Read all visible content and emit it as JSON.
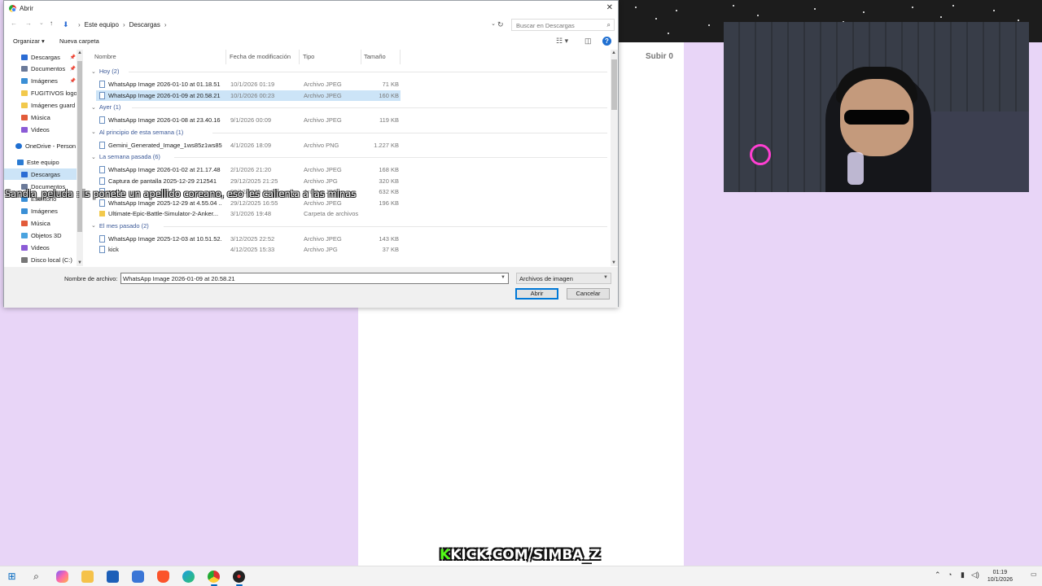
{
  "dialog": {
    "title": "Abrir",
    "close_glyph": "✕",
    "nav": {
      "back": "←",
      "forward": "→",
      "recent": "⌄",
      "up": "↑"
    },
    "breadcrumb": [
      "Este equipo",
      "Descargas"
    ],
    "breadcrumb_sep": "›",
    "search_placeholder": "Buscar en Descargas",
    "toolbar": {
      "organize": "Organizar ▾",
      "new_folder": "Nueva carpeta",
      "help": "?"
    },
    "sidebar": [
      {
        "label": "Descargas",
        "icon": "download-icon",
        "pinned": true
      },
      {
        "label": "Documentos",
        "icon": "document-icon",
        "pinned": true
      },
      {
        "label": "Imágenes",
        "icon": "image-icon",
        "pinned": true
      },
      {
        "label": "FUGITIVOS logo",
        "icon": "folder-icon"
      },
      {
        "label": "Imágenes guard",
        "icon": "folder-icon"
      },
      {
        "label": "Música",
        "icon": "music-icon"
      },
      {
        "label": "Videos",
        "icon": "video-icon"
      },
      {
        "label": "OneDrive - Person",
        "icon": "cloud-icon"
      },
      {
        "label": "Este equipo",
        "icon": "pc-icon"
      },
      {
        "label": "Descargas",
        "icon": "download-icon",
        "selected": true
      },
      {
        "label": "Documentos",
        "icon": "document-icon"
      },
      {
        "label": "Escritorio",
        "icon": "desktop-icon"
      },
      {
        "label": "Imágenes",
        "icon": "image-icon"
      },
      {
        "label": "Música",
        "icon": "music-icon"
      },
      {
        "label": "Objetos 3D",
        "icon": "cube-icon"
      },
      {
        "label": "Videos",
        "icon": "video-icon"
      },
      {
        "label": "Disco local (C:)",
        "icon": "disk-icon"
      }
    ],
    "columns": [
      "Nombre",
      "Fecha de modificación",
      "Tipo",
      "Tamaño"
    ],
    "groups": [
      {
        "label": "Hoy (2)",
        "rows": [
          {
            "name": "WhatsApp Image 2026-01-10 at 01.18.51",
            "date": "10/1/2026 01:19",
            "type": "Archivo JPEG",
            "size": "71 KB"
          },
          {
            "name": "WhatsApp Image 2026-01-09 at 20.58.21",
            "date": "10/1/2026 00:23",
            "type": "Archivo JPEG",
            "size": "160 KB",
            "selected": true
          }
        ]
      },
      {
        "label": "Ayer (1)",
        "rows": [
          {
            "name": "WhatsApp Image 2026-01-08 at 23.40.16",
            "date": "9/1/2026 00:09",
            "type": "Archivo JPEG",
            "size": "119 KB"
          }
        ]
      },
      {
        "label": "Al principio de esta semana (1)",
        "rows": [
          {
            "name": "Gemini_Generated_Image_1ws85z1ws85z...",
            "date": "4/1/2026 18:09",
            "type": "Archivo PNG",
            "size": "1.227 KB"
          }
        ]
      },
      {
        "label": "La semana pasada (6)",
        "rows": [
          {
            "name": "WhatsApp Image 2026-01-02 at 21.17.48",
            "date": "2/1/2026 21:20",
            "type": "Archivo JPEG",
            "size": "168 KB"
          },
          {
            "name": "Captura de pantalla 2025-12-29 212541",
            "date": "29/12/2025 21:25",
            "type": "Archivo JPG",
            "size": "320 KB"
          },
          {
            "name": "cap 1",
            "date": "29/12/2025 21:24",
            "type": "Archivo JPG",
            "size": "632 KB"
          },
          {
            "name": "WhatsApp Image 2025-12-29 at 4.55.04 ...",
            "date": "29/12/2025 16:55",
            "type": "Archivo JPEG",
            "size": "196 KB"
          },
          {
            "name": "Ultimate-Epic-Battle-Simulator-2-Anker...",
            "date": "3/1/2026 19:48",
            "type": "Carpeta de archivos",
            "size": "",
            "folder": true
          }
        ]
      },
      {
        "label": "El mes pasado (2)",
        "rows": [
          {
            "name": "WhatsApp Image 2025-12-03 at 10.51.52...",
            "date": "3/12/2025 22:52",
            "type": "Archivo JPEG",
            "size": "143 KB"
          },
          {
            "name": "kick",
            "date": "4/12/2025 15:33",
            "type": "Archivo JPG",
            "size": "37 KB"
          }
        ]
      }
    ],
    "filename_label": "Nombre de archivo:",
    "filename_value": "WhatsApp Image 2026-01-09 at 20.58.21",
    "filter_value": "Archivos de imagen",
    "open_button": "Abrir",
    "cancel_button": "Cancelar"
  },
  "background": {
    "upload_label": "Subir 0"
  },
  "overlay": {
    "chat_user": "Sandia_peluda",
    "chat_message": ": is ponete un apellido coreano, eso les calienta a las minas",
    "stream_k": "K",
    "stream_url": "KICK.COM/SIMBA_Z"
  },
  "taskbar": {
    "time": "01:19",
    "date": "10/1/2026",
    "apps": [
      "windows-start-icon",
      "search-icon",
      "copilot-icon",
      "file-explorer-icon",
      "store-icon",
      "app-icon",
      "brave-icon",
      "edge-icon",
      "chrome-icon",
      "obs-icon"
    ]
  },
  "colors": {
    "accent": "#0078d7",
    "selection": "#cce4f7",
    "background": "#e8d5f7",
    "kick_green": "#53fc18"
  }
}
